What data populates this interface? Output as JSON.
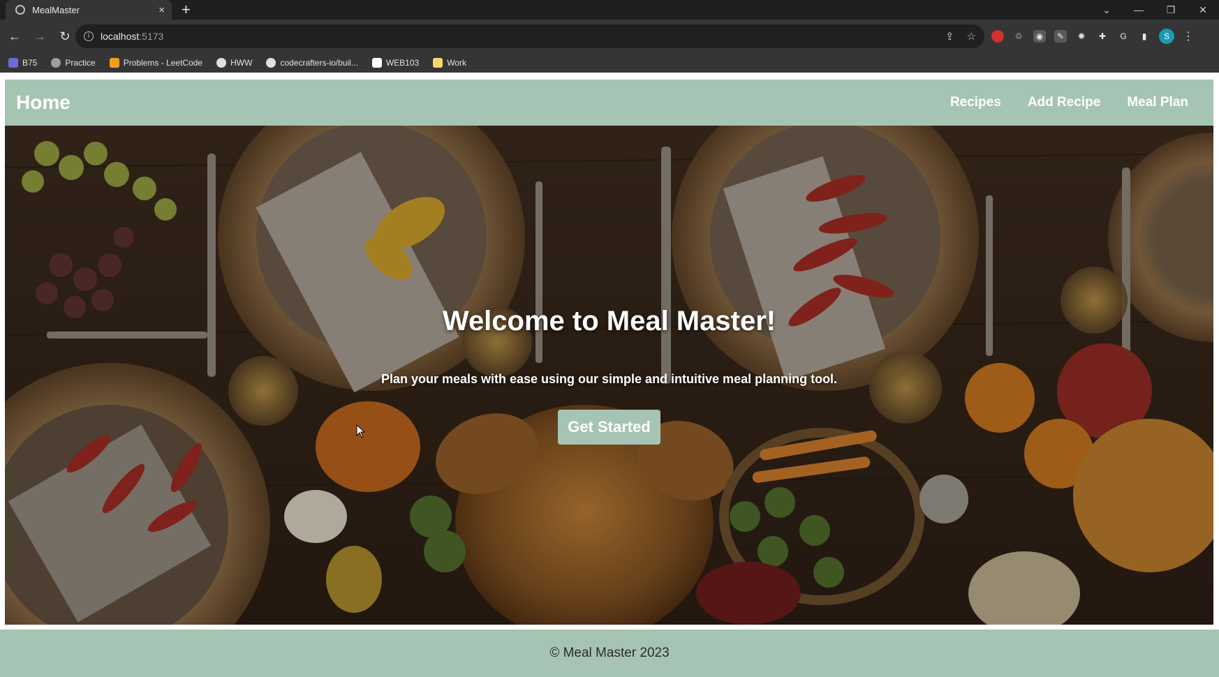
{
  "browser": {
    "tab_title": "MealMaster",
    "tab_close": "×",
    "new_tab": "+",
    "url_host": "localhost",
    "url_port": ":5173",
    "profile_initial": "S",
    "window_controls": [
      "⌄",
      "—",
      "❐",
      "✕"
    ],
    "bookmarks": [
      {
        "label": "B75",
        "icon": "code-icon",
        "color": "#6b6bd6"
      },
      {
        "label": "Practice",
        "icon": "flame-icon",
        "color": "#9e9e9e"
      },
      {
        "label": "Problems - LeetCode",
        "icon": "leetcode-icon",
        "color": "#f0a020"
      },
      {
        "label": "HWW",
        "icon": "github-icon",
        "color": "#e0e0e0"
      },
      {
        "label": "codecrafters-io/buil...",
        "icon": "github-icon",
        "color": "#e0e0e0"
      },
      {
        "label": "WEB103",
        "icon": "codepath-icon",
        "color": "#ffffff"
      },
      {
        "label": "Work",
        "icon": "folder-icon",
        "color": "#f5d76e"
      }
    ]
  },
  "navbar": {
    "brand": "Home",
    "links": [
      "Recipes",
      "Add Recipe",
      "Meal Plan"
    ]
  },
  "hero": {
    "title": "Welcome to Meal Master!",
    "subtitle": "Plan your meals with ease using our simple and intuitive meal planning tool.",
    "cta_label": "Get Started"
  },
  "footer": {
    "text": "© Meal Master 2023"
  },
  "colors": {
    "accent": "#a6c4b3",
    "chrome_dark": "#353535"
  }
}
